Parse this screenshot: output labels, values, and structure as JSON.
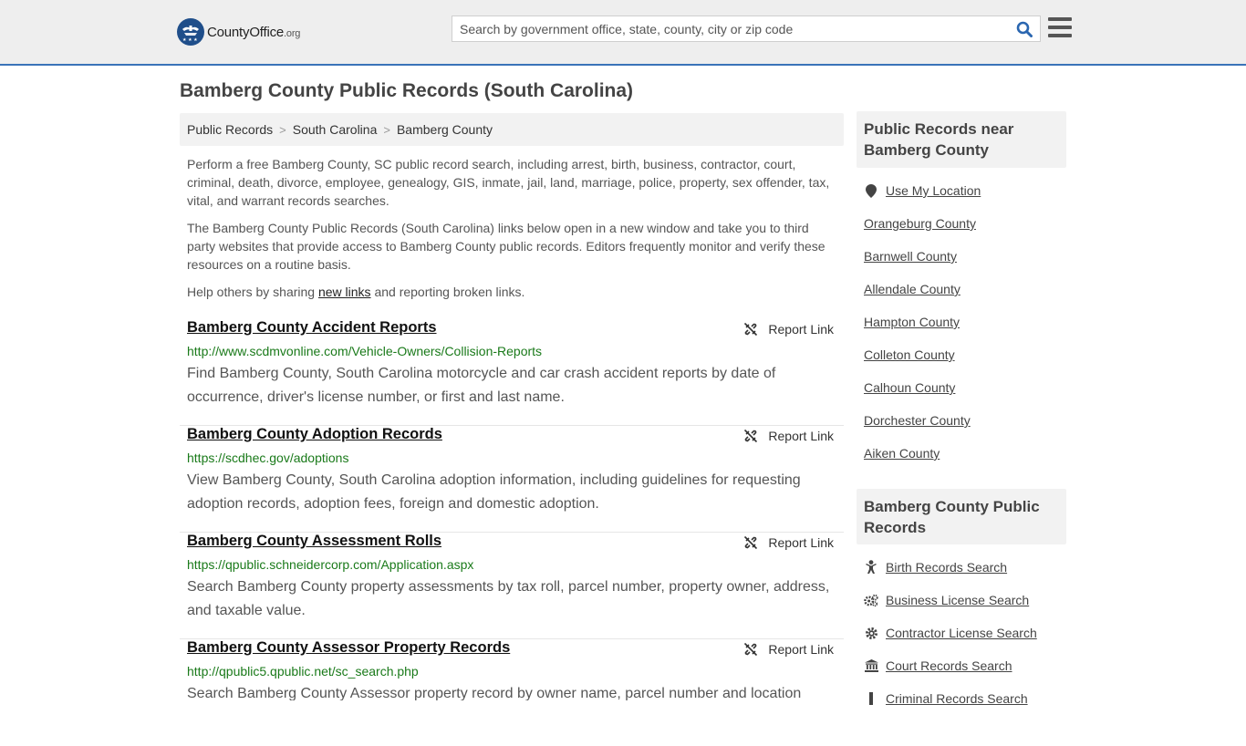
{
  "header": {
    "logo_main": "CountyOffice",
    "logo_tld": ".org",
    "search_placeholder": "Search by government office, state, county, city or zip code"
  },
  "page_title": "Bamberg County Public Records (South Carolina)",
  "breadcrumb": [
    "Public Records",
    "South Carolina",
    "Bamberg County"
  ],
  "intro": {
    "p1": "Perform a free Bamberg County, SC public record search, including arrest, birth, business, contractor, court, criminal, death, divorce, employee, genealogy, GIS, inmate, jail, land, marriage, police, property, sex offender, tax, vital, and warrant records searches.",
    "p2": "The Bamberg County Public Records (South Carolina) links below open in a new window and take you to third party websites that provide access to Bamberg County public records. Editors frequently monitor and verify these resources on a routine basis.",
    "p3_before": "Help others by sharing ",
    "p3_link": "new links",
    "p3_after": " and reporting broken links."
  },
  "report_label": "Report Link",
  "records": [
    {
      "title": "Bamberg County Accident Reports",
      "url": "http://www.scdmvonline.com/Vehicle-Owners/Collision-Reports",
      "desc": "Find Bamberg County, South Carolina motorcycle and car crash accident reports by date of occurrence, driver's license number, or first and last name."
    },
    {
      "title": "Bamberg County Adoption Records",
      "url": "https://scdhec.gov/adoptions",
      "desc": "View Bamberg County, South Carolina adoption information, including guidelines for requesting adoption records, adoption fees, foreign and domestic adoption."
    },
    {
      "title": "Bamberg County Assessment Rolls",
      "url": "https://qpublic.schneidercorp.com/Application.aspx",
      "desc": "Search Bamberg County property assessments by tax roll, parcel number, property owner, address, and taxable value."
    },
    {
      "title": "Bamberg County Assessor Property Records",
      "url": "http://qpublic5.qpublic.net/sc_search.php",
      "desc": "Search Bamberg County Assessor property record by owner name, parcel number and location"
    }
  ],
  "sidebar": {
    "nearby_heading": "Public Records near Bamberg County",
    "use_location": "Use My Location",
    "nearby": [
      "Orangeburg County",
      "Barnwell County",
      "Allendale County",
      "Hampton County",
      "Colleton County",
      "Calhoun County",
      "Dorchester County",
      "Aiken County"
    ],
    "records_heading": "Bamberg County Public Records",
    "record_links": [
      {
        "label": "Birth Records Search",
        "icon": "baby-icon"
      },
      {
        "label": "Business License Search",
        "icon": "gears-icon"
      },
      {
        "label": "Contractor License Search",
        "icon": "gear-icon"
      },
      {
        "label": "Court Records Search",
        "icon": "courthouse-icon"
      },
      {
        "label": "Criminal Records Search",
        "icon": "handcuffs-icon"
      }
    ]
  },
  "colors": {
    "accent_border": "#3a73b8",
    "url_green": "#1a7a1a",
    "logo_blue": "#1f4e8a"
  }
}
